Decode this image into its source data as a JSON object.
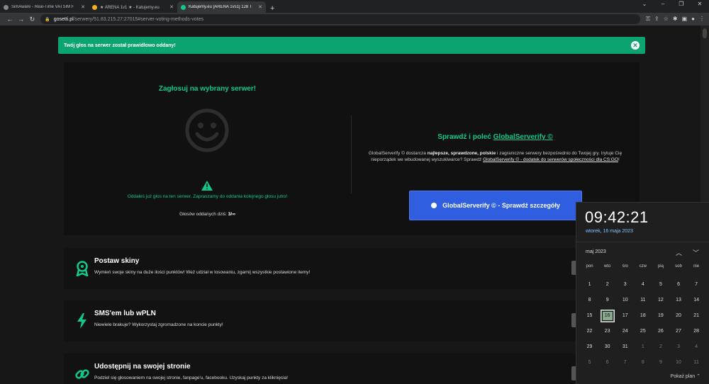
{
  "tabs": [
    {
      "title": "SimAware - Real-Time VATSIM F",
      "active": false
    },
    {
      "title": "★ ARENA 1v1 ★ - Katujemy.eu",
      "active": false
    },
    {
      "title": "Katujemy.eu [ARENA 1vs1] 128 T",
      "active": true
    }
  ],
  "new_tab_icon": "+",
  "omnibox": {
    "domain": "gosetti.pl",
    "path": "/serwery/51.83.215.27:27015#server-voting-methods-votes"
  },
  "alert": {
    "message": "Twój głos na serwer został prawidłowo oddany!"
  },
  "vote": {
    "title": "Zagłosuj na wybrany serwer!",
    "info": "Oddałeś już głos na ten serwer. Zapraszamy do oddania kolejnego głosu jutro!",
    "count_label": "Głosów oddanych dziś:",
    "count_value": "3/∞"
  },
  "recommend": {
    "title_prefix": "Sprawdź i poleć",
    "title_link": "GlobalServerify ©",
    "desc_1": "GlobalServerify © dostarcza",
    "desc_bold": "najlepsze, sprawdzone, polskie",
    "desc_2": "i zagraniczne serwery bezpośrednio do Twojej gry. Irytuje Cię nieporządek we wbudowanej wyszukiwarce? Sprawdź",
    "desc_link": "GlobalServerify © - dodatek do serwerów społeczności dla CS:GO",
    "desc_end": "!",
    "button": "GlobalServerify © - Sprawdź szczegóły"
  },
  "cards": [
    {
      "title": "Postaw skiny",
      "desc": "Wymień swoje skiny na duże ilości punktów! Weź udział w losowaniu, zgarnij wszystkie postawione itemy!",
      "icon": "award-icon"
    },
    {
      "title": "SMS'em lub wPLN",
      "desc": "Niewiele brakuje? Wykorzystaj zgromadzone na koncie punkty!",
      "icon": "lightning-icon"
    },
    {
      "title": "Udostępnij na swojej stronie",
      "desc": "Podziel się głosowaniem na swojej stronie, fanpage'u, facebooku. Uzyskaj punkty za kliknięcia!",
      "icon": "link-icon"
    }
  ],
  "calendar": {
    "time": "09:42:21",
    "date": "wtorek, 16 maja 2023",
    "month": "maj 2023",
    "weekdays": [
      "pon",
      "wto",
      "śro",
      "czw",
      "pią",
      "sob",
      "nie"
    ],
    "weeks": [
      [
        "1",
        "2",
        "3",
        "4",
        "5",
        "6",
        "7"
      ],
      [
        "8",
        "9",
        "10",
        "11",
        "12",
        "13",
        "14"
      ],
      [
        "15",
        "16",
        "17",
        "18",
        "19",
        "20",
        "21"
      ],
      [
        "22",
        "23",
        "24",
        "25",
        "26",
        "27",
        "28"
      ],
      [
        "29",
        "30",
        "31",
        "1",
        "2",
        "3",
        "4"
      ],
      [
        "5",
        "6",
        "7",
        "8",
        "9",
        "10",
        "11"
      ]
    ],
    "today": "16",
    "show_plan": "Pokaż plan"
  },
  "colors": {
    "accent": "#12c98a",
    "alert": "#0ba36f",
    "button": "#2f5ee0"
  }
}
